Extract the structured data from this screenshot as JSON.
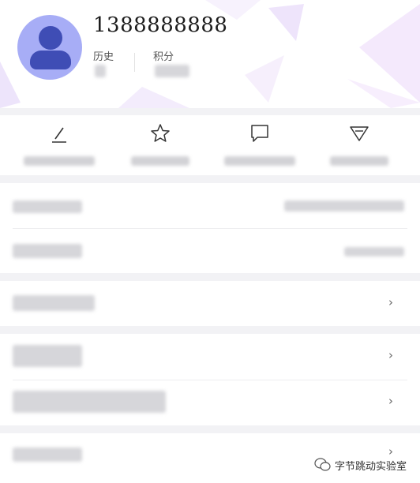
{
  "profile": {
    "phone": "1388888888",
    "history_label": "历史",
    "points_label": "积分"
  },
  "quick_actions": [
    {
      "icon": "pen-icon"
    },
    {
      "icon": "star-icon"
    },
    {
      "icon": "comment-icon"
    },
    {
      "icon": "diamond-icon"
    }
  ],
  "menu": {
    "chevron": "›"
  },
  "watermark": {
    "text": "字节跳动实验室",
    "icon": "wechat-icon"
  },
  "colors": {
    "avatar_bg": "#a7adf6",
    "avatar_fg": "#3f4db5",
    "page_bg": "#f2f2f5"
  }
}
